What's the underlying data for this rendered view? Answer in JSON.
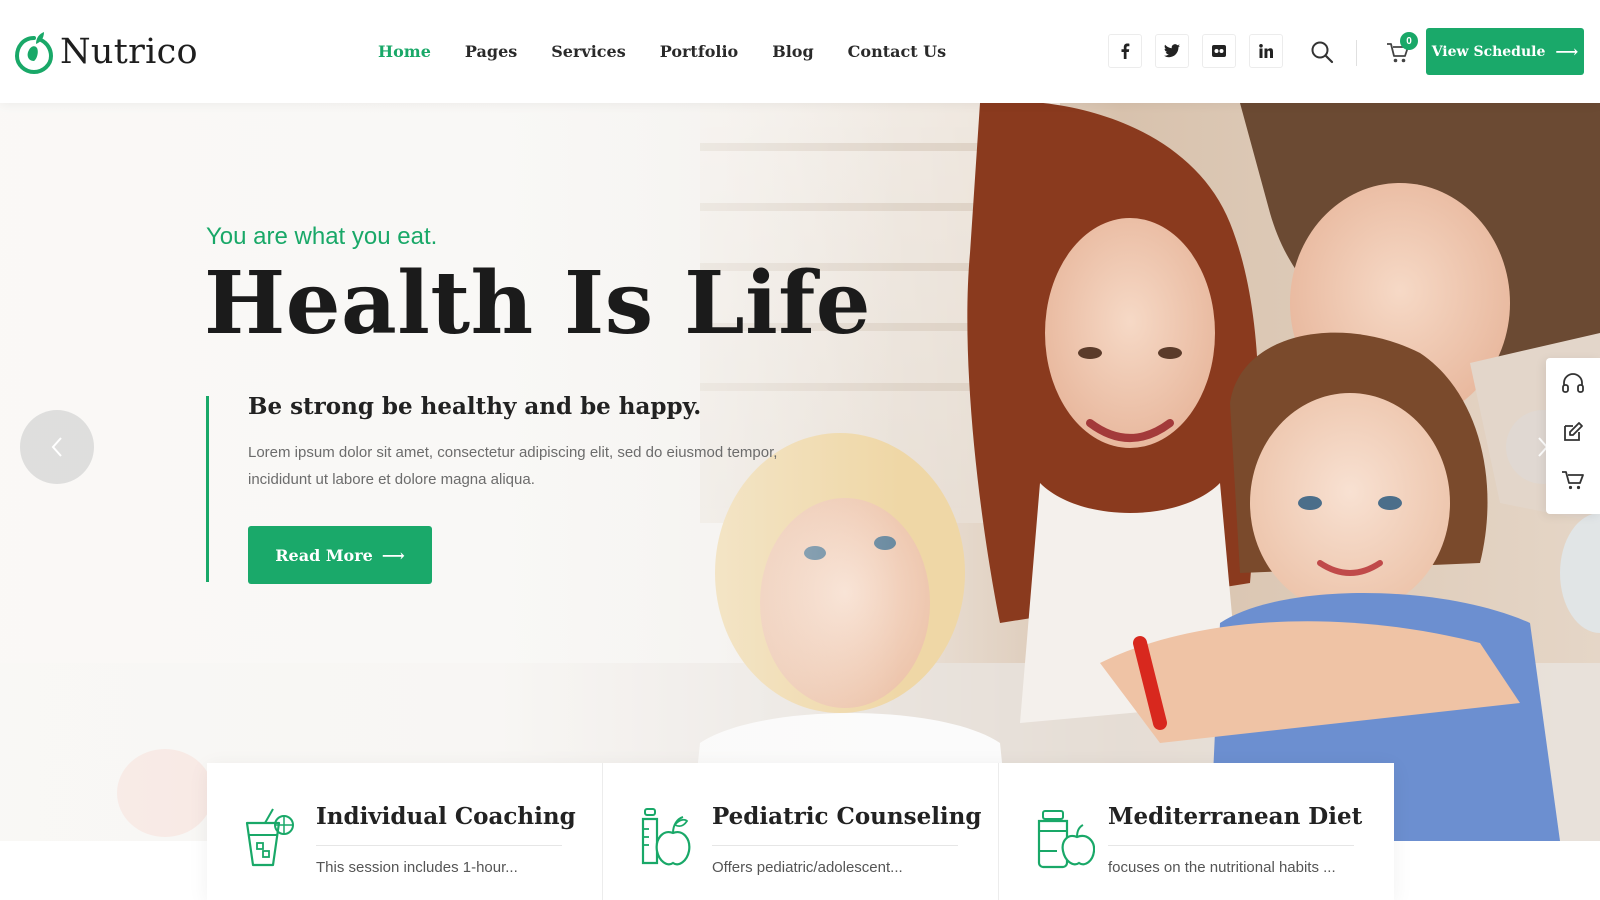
{
  "brand": {
    "name": "Nutrico",
    "accent": "#1aa96a"
  },
  "nav": {
    "items": [
      {
        "label": "Home",
        "active": true
      },
      {
        "label": "Pages",
        "active": false
      },
      {
        "label": "Services",
        "active": false
      },
      {
        "label": "Portfolio",
        "active": false
      },
      {
        "label": "Blog",
        "active": false
      },
      {
        "label": "Contact Us",
        "active": false
      }
    ]
  },
  "header": {
    "socials": [
      {
        "icon": "facebook-icon",
        "glyph": "f"
      },
      {
        "icon": "twitter-icon",
        "glyph": "t"
      },
      {
        "icon": "flickr-icon",
        "glyph": "••"
      },
      {
        "icon": "linkedin-icon",
        "glyph": "in"
      }
    ],
    "search_icon": "search-icon",
    "cart_icon": "cart-icon",
    "cart_count": "0",
    "cta_label": "View Schedule",
    "cta_icon": "arrow-right-icon"
  },
  "hero": {
    "tagline": "You are what you eat.",
    "title": "Health Is Life",
    "subtitle": "Be strong be healthy and be happy.",
    "body": "Lorem ipsum dolor sit amet, consectetur adipiscing elit, sed do eiusmod tempor, incididunt ut labore et dolore magna aliqua.",
    "button_label": "Read More",
    "prev_icon": "chevron-left-icon",
    "next_icon": "chevron-right-icon"
  },
  "side_panel": {
    "icons": [
      "headset-icon",
      "edit-icon",
      "cart-icon"
    ]
  },
  "services": [
    {
      "title": "Individual Coaching",
      "desc": "This session includes 1-hour...",
      "icon": "juice-glass-icon"
    },
    {
      "title": "Pediatric Counseling",
      "desc": "Offers pediatric/adolescent...",
      "icon": "baby-bottle-apple-icon"
    },
    {
      "title": "Mediterranean Diet",
      "desc": "focuses on the nutritional habits ...",
      "icon": "jar-apple-icon"
    }
  ]
}
